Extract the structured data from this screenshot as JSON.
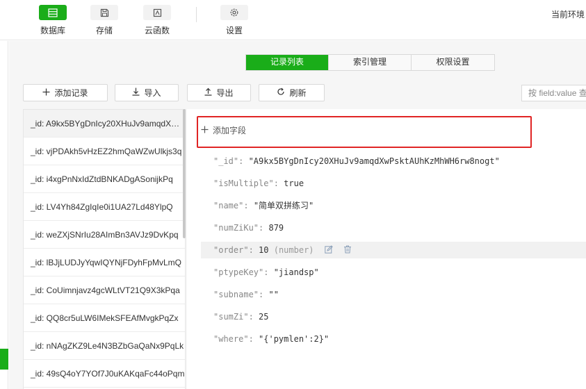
{
  "toolbar": {
    "items": [
      {
        "label": "数据库",
        "icon": "database-icon",
        "active": true
      },
      {
        "label": "存储",
        "icon": "storage-icon",
        "active": false
      },
      {
        "label": "云函数",
        "icon": "cloud-function-icon",
        "active": false
      },
      {
        "label": "设置",
        "icon": "gear-icon",
        "active": false
      }
    ],
    "env_label": "当前环境"
  },
  "tabs": [
    {
      "label": "记录列表",
      "active": true
    },
    {
      "label": "索引管理",
      "active": false
    },
    {
      "label": "权限设置",
      "active": false
    }
  ],
  "actions": {
    "add_record": "添加记录",
    "import": "导入",
    "export": "导出",
    "refresh": "刷新"
  },
  "search": {
    "placeholder": "按 field:value 查"
  },
  "records": [
    "_id: A9kx5BYgDnIcy20XHuJv9amqdXwPsktAUhKzMhWH6rw8nogt",
    "_id: vjPDAkh5vHzEZ2hmQaWZwUlkjs3q",
    "_id: i4xgPnNxIdZtdBNKADgASonijkPq",
    "_id: LV4Yh84ZgIqIe0i1UA27Ld48YlpQ",
    "_id: weZXjSNrIu28AImBn3AVJz9DvKpq",
    "_id: lBJjLUDJyYqwIQYNjFDyhFpMvLmQ",
    "_id: CoUimnjavz4gcWLtVT21Q9X3kPqa",
    "_id: QQ8cr5uLW6IMekSFEAfMvgkPqZx",
    "_id: nNAgZKZ9Le4N3BZbGaQaNx9PqLk",
    "_id: 49sQ4oY7YOf7J0uKAKqaFc44oPqm"
  ],
  "detail": {
    "add_field": "添加字段",
    "fields": [
      {
        "key": "\"_id\"",
        "value": "\"A9kx5BYgDnIcy20XHuJv9amqdXwPsktAUhKzMhWH6rw8nogt\""
      },
      {
        "key": "\"isMultiple\"",
        "value": "true"
      },
      {
        "key": "\"name\"",
        "value": "\"简单双拼练习\""
      },
      {
        "key": "\"numZiKu\"",
        "value": "879"
      },
      {
        "key": "\"order\"",
        "value": "10",
        "type": "(number)"
      },
      {
        "key": "\"ptypeKey\"",
        "value": "\"jiandsp\""
      },
      {
        "key": "\"subname\"",
        "value": "\"\""
      },
      {
        "key": "\"sumZi\"",
        "value": "25"
      },
      {
        "key": "\"where\"",
        "value": "\"{'pymlen':2}\""
      }
    ]
  },
  "colors": {
    "accent": "#1aad19",
    "highlight": "#e02424"
  }
}
